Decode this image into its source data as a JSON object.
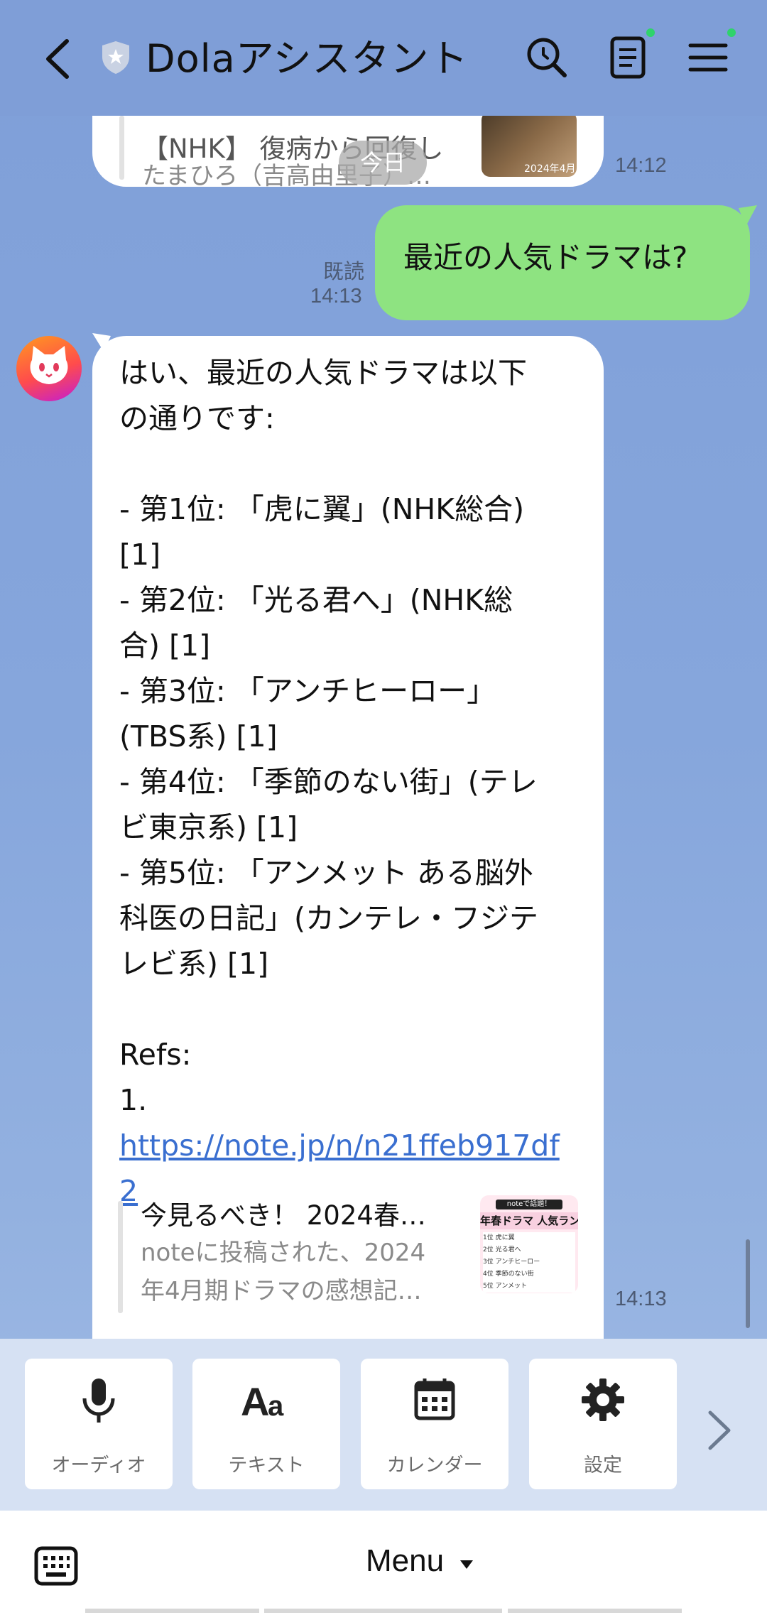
{
  "header": {
    "back_icon": "chevron-left-icon",
    "shield_icon": "shield-icon",
    "title": "Dolaアシスタント",
    "search_icon": "search-icon",
    "notes_icon": "notes-icon",
    "menu_icon": "hamburger-icon",
    "notification_dot_color": "#2fd36b"
  },
  "chat": {
    "top_preview": {
      "title": "【NHK】 復病から回復し",
      "desc": "たまひろ（吉高由里子）…",
      "thumb_label": "2024年4月",
      "time": "14:12"
    },
    "date_chip": "今日",
    "user_message": {
      "text": "最近の人気ドラマは?",
      "read_label": "既読",
      "time": "14:13"
    },
    "bot_message": {
      "line1": "はい、最近の人気ドラマは以下",
      "line2": "の通りです:",
      "line3": "- 第1位: 「虎に翼」(NHK総合)",
      "line4": "[1]",
      "line5": "- 第2位: 「光る君へ」(NHK総",
      "line6": "合) [1]",
      "line7": "- 第3位: 「アンチヒーロー」",
      "line8": "(TBS系) [1]",
      "line9": "- 第4位: 「季節のない街」(テレ",
      "line10": "ビ東京系) [1]",
      "line11": "- 第5位: 「アンメット ある脳外",
      "line12": "科医の日記」(カンテレ・フジテ",
      "line13": "レビ系) [1]",
      "refs_label": "Refs:",
      "ref_num": "1.",
      "link_line1": "https://note.jp/n/n21ffeb917df",
      "link_line2": "2",
      "preview_title": "今見るべき！ 2024春…",
      "preview_desc1": "noteに投稿された、2024",
      "preview_desc2": "年4月期ドラマの感想記…",
      "thumb": {
        "badge": "noteで話題！",
        "heading": "年春ドラマ 人気ランキ",
        "rows": [
          "1位 虎に翼",
          "2位 光る君へ",
          "3位 アンチヒーロー",
          "4位 季節のない街",
          "5位 アンメット"
        ]
      },
      "time": "14:13"
    }
  },
  "rich_menu": {
    "buttons": [
      {
        "label": "オーディオ",
        "icon": "microphone-icon"
      },
      {
        "label": "テキスト",
        "icon": "text-aa-icon"
      },
      {
        "label": "カレンダー",
        "icon": "calendar-icon"
      },
      {
        "label": "設定",
        "icon": "gear-icon"
      }
    ],
    "next_icon": "chevron-right-icon"
  },
  "bottom_bar": {
    "keyboard_icon": "keyboard-icon",
    "menu_label": "Menu",
    "caret_icon": "caret-down-icon"
  }
}
